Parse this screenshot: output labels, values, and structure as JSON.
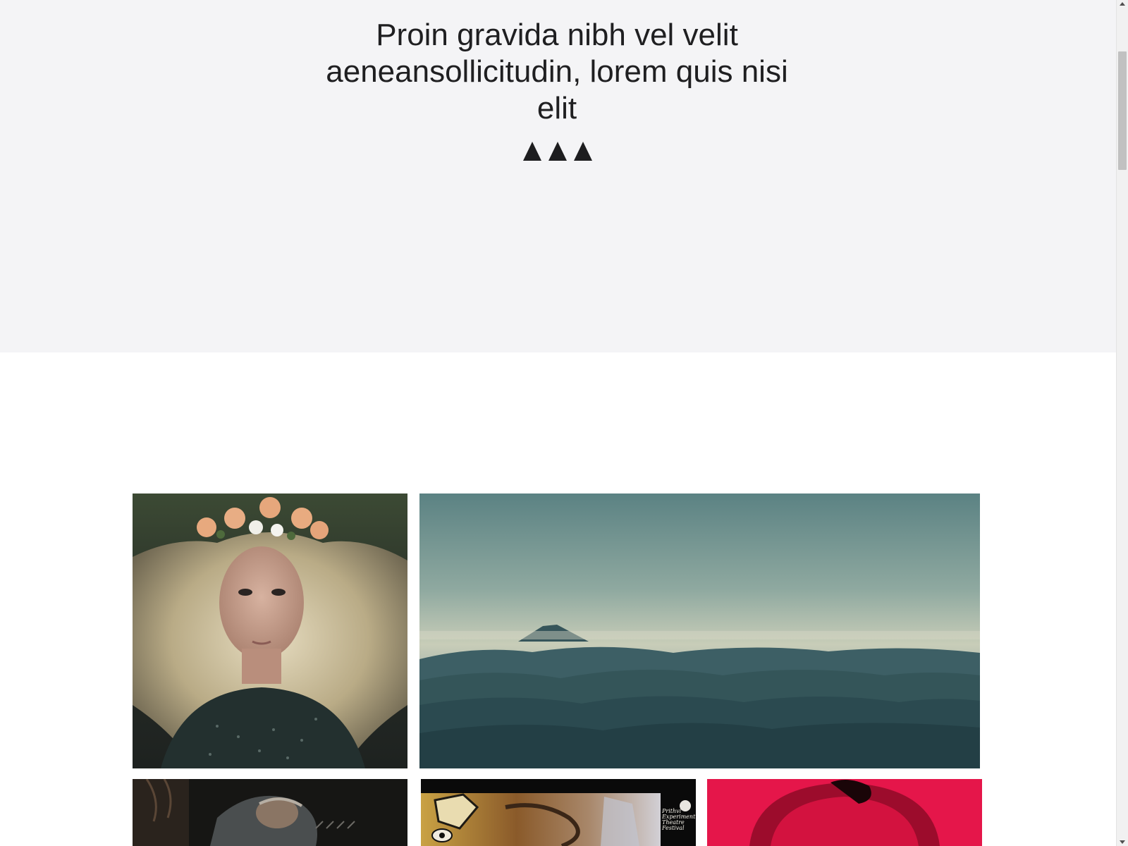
{
  "hero": {
    "title": "Proin gravida nibh vel velit aeneansollicitudin, lorem quis nisi elit",
    "divider_icon": "triangle-ornament-icon",
    "background_color": "#f4f4f6",
    "text_color": "#1f1f21"
  },
  "gallery": {
    "photos": [
      {
        "subject": "woman with flower crown"
      },
      {
        "subject": "misty mountain landscape"
      },
      {
        "subject": "man in dark workshop"
      },
      {
        "subject": "graffiti festival poster"
      },
      {
        "subject": "portrait on red background"
      }
    ]
  },
  "poster": {
    "line1": "Prithvi",
    "line2": "Experiment",
    "line3": "Theatre",
    "line4": "Festival"
  },
  "scrollbar": {
    "position_fraction": 0.06
  }
}
